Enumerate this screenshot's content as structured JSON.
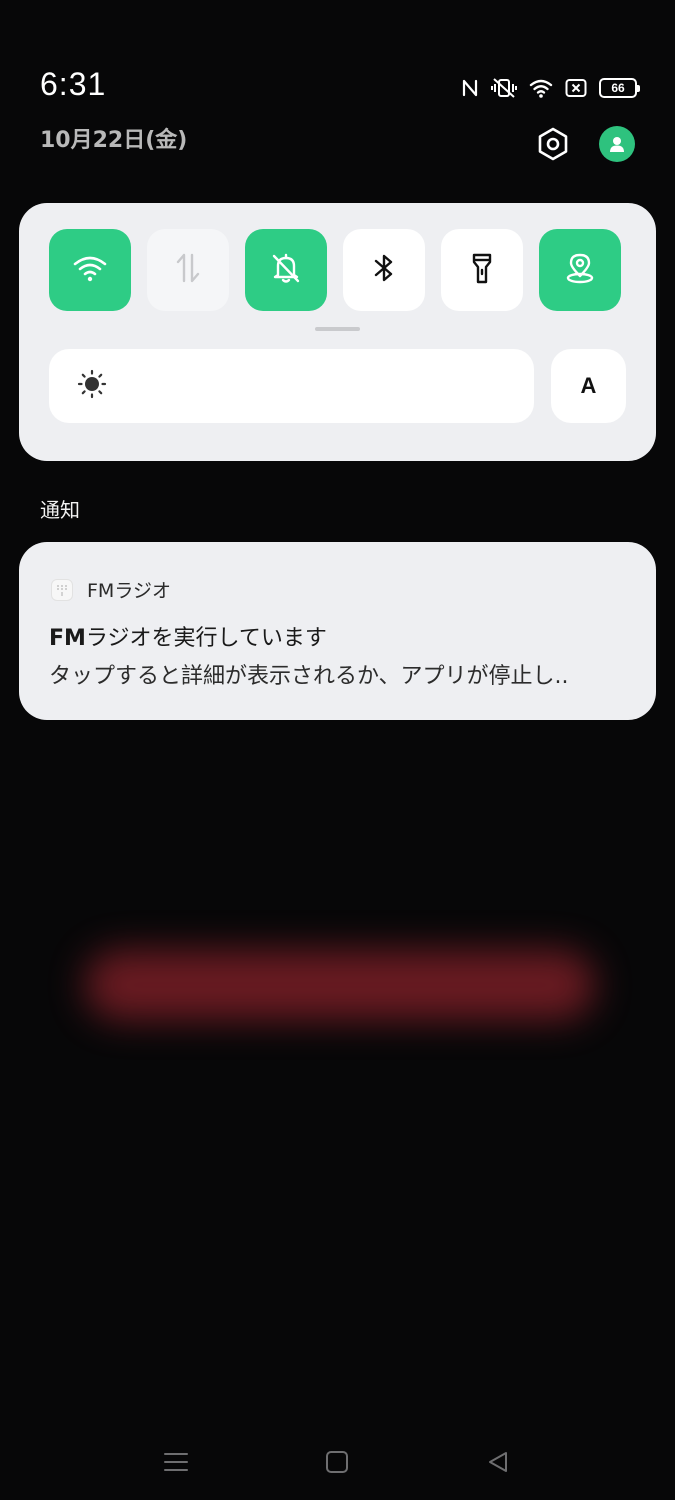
{
  "status_bar": {
    "time": "6:31",
    "date": "10月22日(金)",
    "battery_level": "66",
    "icons": [
      "nfc-icon",
      "vibrate-off-icon",
      "wifi-icon",
      "sim-missing-icon",
      "battery-icon"
    ]
  },
  "header": {
    "icons": [
      "settings-icon",
      "user-icon"
    ]
  },
  "quick_settings": {
    "tiles": [
      {
        "name": "wifi",
        "icon": "wifi-icon",
        "state": "on"
      },
      {
        "name": "mobile-data",
        "icon": "data-transfer-icon",
        "state": "disabled"
      },
      {
        "name": "silent",
        "icon": "bell-off-icon",
        "state": "on"
      },
      {
        "name": "bluetooth",
        "icon": "bluetooth-icon",
        "state": "off"
      },
      {
        "name": "flashlight",
        "icon": "flashlight-icon",
        "state": "off"
      },
      {
        "name": "location",
        "icon": "location-icon",
        "state": "on"
      }
    ],
    "brightness_icon": "sun-icon",
    "auto_brightness_label": "A"
  },
  "notifications": {
    "section_label": "通知",
    "items": [
      {
        "app_name": "FMラジオ",
        "title": "FMラジオを実行しています",
        "title_bold": "FM",
        "title_rest": "ラジオを実行しています",
        "body": "タップすると詳細が表示されるか、アプリが停止し.."
      }
    ]
  },
  "navigation": {
    "buttons": [
      "menu-icon",
      "home-icon",
      "back-icon"
    ]
  },
  "colors": {
    "accent_green": "#2ecc85",
    "panel_bg": "#eeeff2",
    "background": "#070708"
  }
}
